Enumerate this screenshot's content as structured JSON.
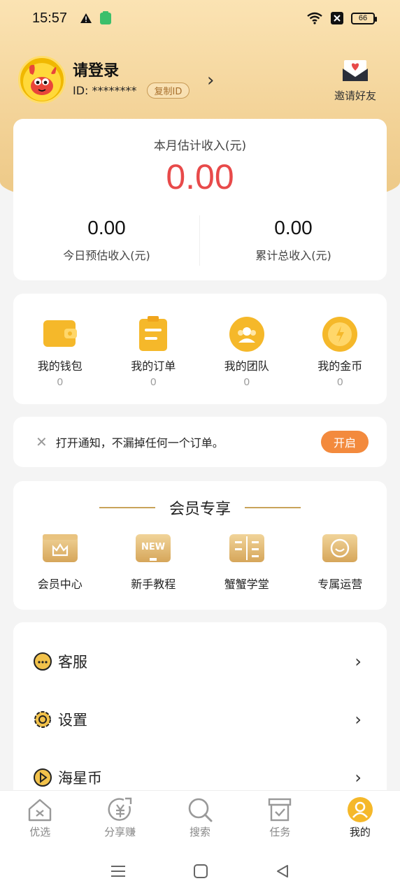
{
  "status_bar": {
    "time": "15:57",
    "battery": "66"
  },
  "profile": {
    "name": "请登录",
    "id_label": "ID: ********",
    "copy_label": "复制ID",
    "invite_label": "邀请好友"
  },
  "earnings": {
    "title": "本月估计收入(元)",
    "amount": "0.00",
    "today_value": "0.00",
    "today_label": "今日预估收入(元)",
    "total_value": "0.00",
    "total_label": "累计总收入(元)"
  },
  "quick": [
    {
      "label": "我的钱包",
      "count": "0",
      "icon": "wallet-icon"
    },
    {
      "label": "我的订单",
      "count": "0",
      "icon": "order-icon"
    },
    {
      "label": "我的团队",
      "count": "0",
      "icon": "team-icon"
    },
    {
      "label": "我的金币",
      "count": "0",
      "icon": "coin-icon"
    }
  ],
  "notice": {
    "text": "打开通知，不漏掉任何一个订单。",
    "button": "开启"
  },
  "member": {
    "title": "会员专享",
    "items": [
      {
        "label": "会员中心",
        "icon": "crown-card-icon"
      },
      {
        "label": "新手教程",
        "icon": "new-screen-icon"
      },
      {
        "label": "蟹蟹学堂",
        "icon": "book-icon"
      },
      {
        "label": "专属运营",
        "icon": "smile-chat-icon"
      }
    ]
  },
  "menu": [
    {
      "label": "客服",
      "icon": "chat-bubble-icon"
    },
    {
      "label": "设置",
      "icon": "gear-icon"
    },
    {
      "label": "海星币",
      "icon": "star-coin-icon"
    }
  ],
  "tabs": [
    {
      "label": "优选",
      "icon": "home-icon"
    },
    {
      "label": "分享赚",
      "icon": "share-yen-icon"
    },
    {
      "label": "搜索",
      "icon": "search-icon"
    },
    {
      "label": "任务",
      "icon": "task-icon"
    },
    {
      "label": "我的",
      "icon": "profile-icon"
    }
  ],
  "colors": {
    "accent": "#e84a4a",
    "gold": "#f2c24b",
    "button": "#f38a3d"
  }
}
